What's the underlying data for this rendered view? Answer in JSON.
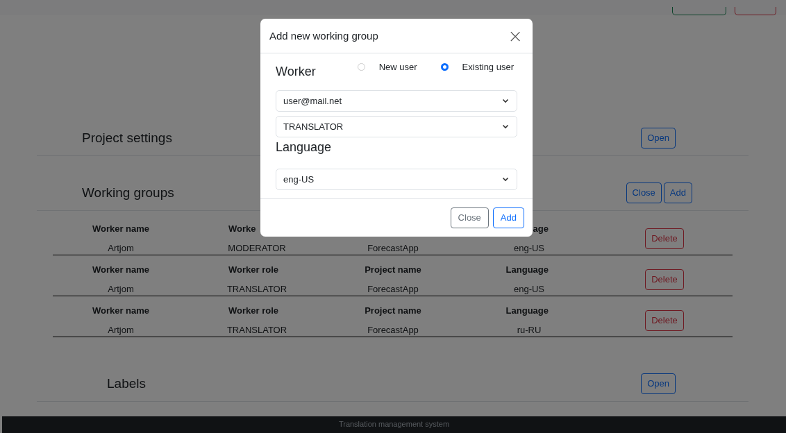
{
  "sections": [
    {
      "kind": "settings",
      "title": "Project settings",
      "buttons": [
        {
          "label": "Open",
          "kind": "primary"
        }
      ]
    },
    {
      "kind": "groups",
      "title": "Working groups",
      "buttons": [
        {
          "label": "Close",
          "kind": "primary"
        },
        {
          "label": "Add",
          "kind": "primary"
        }
      ],
      "rows": [
        {
          "headers": {
            "worker_name": "Worker name",
            "worker_role": "Worke",
            "language": "age"
          },
          "cells": [
            "Artjom",
            "MODERATOR",
            "ForecastApp",
            "eng-US"
          ],
          "action": "Delete"
        },
        {
          "headers": {
            "worker_name": "Worker name",
            "worker_role": "Worker role",
            "project_name": "Project name",
            "language": "Language"
          },
          "cells": [
            "Artjom",
            "TRANSLATOR",
            "ForecastApp",
            "eng-US"
          ],
          "action": "Delete"
        },
        {
          "headers": {
            "worker_name": "Worker name",
            "worker_role": "Worker role",
            "project_name": "Project name",
            "language": "Language"
          },
          "cells": [
            "Artjom",
            "TRANSLATOR",
            "ForecastApp",
            "ru-RU"
          ],
          "action": "Delete"
        }
      ]
    },
    {
      "kind": "labels",
      "title": "Labels",
      "buttons": [
        {
          "label": "Open",
          "kind": "primary"
        }
      ]
    }
  ],
  "footer": "Translation management system",
  "modal": {
    "title": "Add new working group",
    "close_icon": "×",
    "worker_label": "Worker",
    "radios": [
      {
        "label": "New user",
        "selected": false
      },
      {
        "label": "Existing user",
        "selected": true
      }
    ],
    "worker_selects": [
      {
        "value": "user@mail.net"
      },
      {
        "value": "TRANSLATOR"
      }
    ],
    "language_label": "Language",
    "language_select": {
      "value": "eng-US"
    },
    "buttons": [
      {
        "label": "Close",
        "kind": "secondary"
      },
      {
        "label": "Add",
        "kind": "primary"
      }
    ]
  }
}
